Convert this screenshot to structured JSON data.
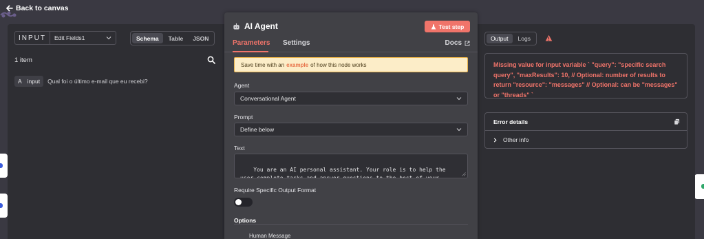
{
  "header": {
    "back_label": "Back to canvas"
  },
  "input_panel": {
    "label": "INPUT",
    "node_select": "Edit Fields1",
    "view_tabs": [
      "Schema",
      "Table",
      "JSON"
    ],
    "active_view": "Schema",
    "item_count": "1 item",
    "schema": [
      {
        "type": "A",
        "key": "input",
        "value": "Qual foi o último e-mail que eu recebi?"
      }
    ]
  },
  "node": {
    "title": "AI Agent",
    "test_button": "Test step",
    "tabs": [
      "Parameters",
      "Settings"
    ],
    "active_tab": "Parameters",
    "docs_label": "Docs",
    "hint": {
      "prefix": "Save time with an",
      "link": "example",
      "suffix": "of how this node works"
    },
    "agent": {
      "label": "Agent",
      "value": "Conversational Agent"
    },
    "prompt": {
      "label": "Prompt",
      "value": "Define below"
    },
    "text": {
      "label": "Text",
      "value": "You are an AI personal assistant. Your role is to help the user complete tasks and answer questions to the best of your ability using the following tools:"
    },
    "output_format": {
      "label": "Require Specific Output Format",
      "enabled": false
    },
    "options": {
      "title": "Options",
      "items": [
        "Human Message"
      ]
    }
  },
  "output_panel": {
    "tabs": [
      "Output",
      "Logs"
    ],
    "active_tab": "Output",
    "error_message": "Missing value for input variable ` \"query\": \"specific search query\", \"maxResults\": 10, // Optional: number of results to return \"resource\": \"messages\" // Optional: can be \"messages\" or \"threads\" `",
    "details_title": "Error details",
    "details_row": "Other info"
  },
  "colors": {
    "accent": "#f0746a",
    "panel": "#2e2e33",
    "node_panel": "#414146",
    "hint_bg": "#fcedc8"
  }
}
